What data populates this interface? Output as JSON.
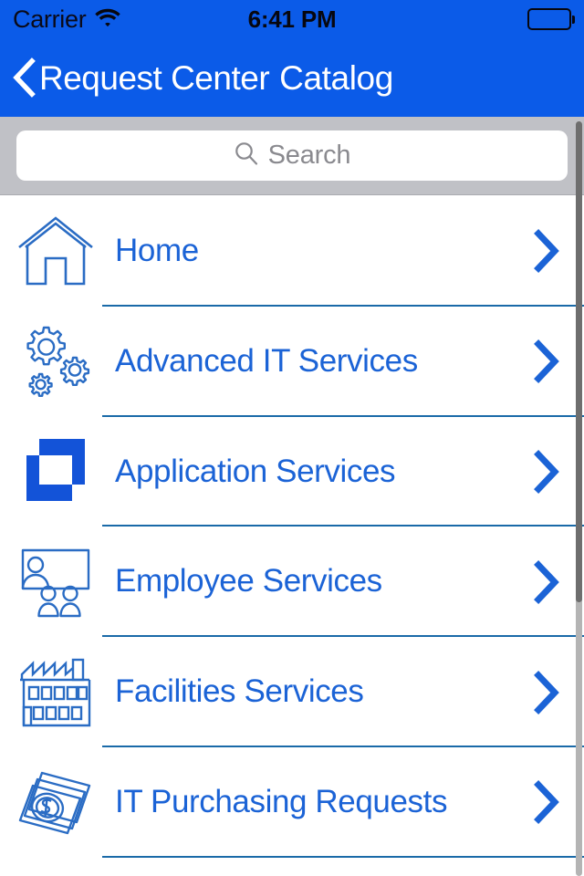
{
  "status_bar": {
    "carrier": "Carrier",
    "wifi_icon": "wifi-icon",
    "time": "6:41 PM",
    "battery_icon": "battery-full-icon"
  },
  "nav": {
    "back_icon": "chevron-left-icon",
    "back_label": "Request Center",
    "title": "Catalog"
  },
  "search": {
    "icon": "search-icon",
    "placeholder": "Search",
    "value": ""
  },
  "colors": {
    "nav_blue": "#0B5BE8",
    "accent_blue": "#1B63D6",
    "search_bg": "#C0C1C6",
    "separator": "#1a6aa8",
    "scroll_thumb": "#6e6e6e"
  },
  "list": {
    "items": [
      {
        "label": "Home",
        "icon": "house-icon",
        "chevron": "chevron-right-icon"
      },
      {
        "label": "Advanced IT Services",
        "icon": "gears-icon",
        "chevron": "chevron-right-icon"
      },
      {
        "label": "Application Services",
        "icon": "squares-icon",
        "chevron": "chevron-right-icon"
      },
      {
        "label": "Employee Services",
        "icon": "people-presentation-icon",
        "chevron": "chevron-right-icon"
      },
      {
        "label": "Facilities Services",
        "icon": "factory-icon",
        "chevron": "chevron-right-icon"
      },
      {
        "label": "IT Purchasing Requests",
        "icon": "money-icon",
        "chevron": "chevron-right-icon"
      }
    ]
  },
  "scrollbar": {
    "name": "vertical-scrollbar"
  }
}
